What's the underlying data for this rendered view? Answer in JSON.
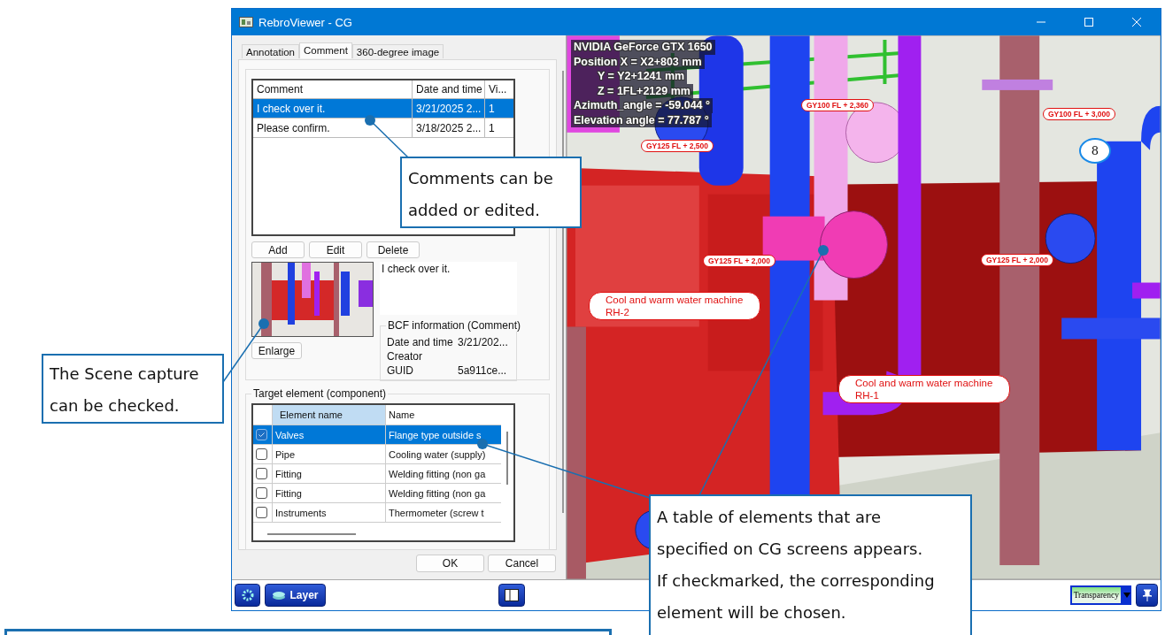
{
  "window": {
    "title": "RebroViewer - CG"
  },
  "tabs": [
    {
      "label": "Annotation",
      "selected": false
    },
    {
      "label": "Comment",
      "selected": true
    },
    {
      "label": "360-degree image",
      "selected": false
    }
  ],
  "comments": {
    "columns": [
      "Comment",
      "Date and time",
      "Vi..."
    ],
    "rows": [
      {
        "comment": "I check over it.",
        "date": "3/21/2025 2...",
        "views": "1",
        "selected": true
      },
      {
        "comment": "Please confirm.",
        "date": "3/18/2025 2...",
        "views": "1",
        "selected": false
      }
    ]
  },
  "comment_buttons": [
    "Add",
    "Edit",
    "Delete"
  ],
  "comment_text": "I check over it.",
  "enlarge_button": "Enlarge",
  "bcf": {
    "title": "BCF information (Comment)",
    "fields": [
      {
        "label": "Date and time",
        "value": "3/21/202..."
      },
      {
        "label": "Creator"
      },
      {
        "label": "GUID",
        "value": "5a911ce..."
      }
    ]
  },
  "target": {
    "title": "Target element (component)",
    "columns": [
      "Element name",
      "Name"
    ],
    "rows": [
      {
        "checked": true,
        "selected": true,
        "element": "Valves",
        "name": "Flange type outside s"
      },
      {
        "checked": false,
        "selected": false,
        "element": "Pipe",
        "name": "Cooling water (supply)"
      },
      {
        "checked": false,
        "selected": false,
        "element": "Fitting",
        "name": "Welding fitting (non ga"
      },
      {
        "checked": false,
        "selected": false,
        "element": "Fitting",
        "name": "Welding fitting (non ga"
      },
      {
        "checked": false,
        "selected": false,
        "element": "Instruments",
        "name": "Thermometer (screw t"
      }
    ]
  },
  "dialog_buttons": [
    "OK",
    "Cancel"
  ],
  "viewport": {
    "info_lines": [
      {
        "kind": "main",
        "text": "NVIDIA GeForce GTX 1650"
      },
      {
        "kind": "main",
        "text": "Position X = X2+803 mm"
      },
      {
        "kind": "sub",
        "text": "Y = Y2+1241 mm"
      },
      {
        "kind": "sub",
        "text": "Z = 1FL+2129 mm"
      },
      {
        "kind": "main",
        "text": "Azimuth_angle = -59.044 °"
      },
      {
        "kind": "main",
        "text": "Elevation angle = 77.787 °"
      }
    ],
    "tags": [
      "GY100 FL + 2,360",
      "GY125 FL + 2,500",
      "GY100 FL + 3,000",
      "GY125 FL + 2,000",
      "GY125 FL + 2,000"
    ],
    "machines": [
      {
        "name": "Cool and warm water machine",
        "code": "RH-2"
      },
      {
        "name": "Cool and warm water machine",
        "code": "RH-1"
      }
    ],
    "badge": "8"
  },
  "toolbar": {
    "layer": "Layer",
    "transparency": "Transparency"
  },
  "callouts": [
    {
      "lines": [
        "Comments can be",
        "added or edited."
      ]
    },
    {
      "lines": [
        "The Scene capture",
        "can be checked."
      ]
    },
    {
      "lines": [
        "A table of elements that are",
        "specified on CG screens appears.",
        "If checkmarked, the corresponding",
        "element will be chosen."
      ]
    }
  ]
}
